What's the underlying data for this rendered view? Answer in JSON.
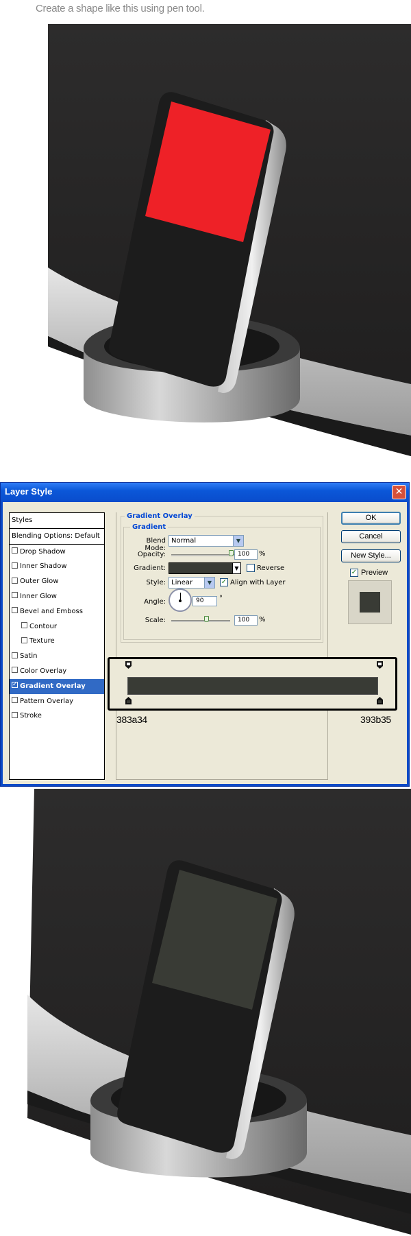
{
  "caption": "Create a shape like this using pen tool.",
  "dialog": {
    "title": "Layer Style",
    "styles_header": "Styles",
    "blending_options": "Blending Options: Default",
    "style_items": [
      {
        "label": "Drop Shadow",
        "checked": false
      },
      {
        "label": "Inner Shadow",
        "checked": false
      },
      {
        "label": "Outer Glow",
        "checked": false
      },
      {
        "label": "Inner Glow",
        "checked": false
      },
      {
        "label": "Bevel and Emboss",
        "checked": false
      },
      {
        "label": "Contour",
        "checked": false
      },
      {
        "label": "Texture",
        "checked": false
      },
      {
        "label": "Satin",
        "checked": false
      },
      {
        "label": "Color Overlay",
        "checked": false
      },
      {
        "label": "Gradient Overlay",
        "checked": true
      },
      {
        "label": "Pattern Overlay",
        "checked": false
      },
      {
        "label": "Stroke",
        "checked": false
      }
    ],
    "section_title": "Gradient Overlay",
    "group_title": "Gradient",
    "blend_mode_label": "Blend Mode:",
    "blend_mode_value": "Normal",
    "opacity_label": "Opacity:",
    "opacity_value": "100",
    "percent": "%",
    "gradient_label": "Gradient:",
    "reverse_label": "Reverse",
    "style_label": "Style:",
    "style_value": "Linear",
    "align_label": "Align with Layer",
    "angle_label": "Angle:",
    "angle_value": "90",
    "degree": "°",
    "scale_label": "Scale:",
    "scale_value": "100",
    "buttons": {
      "ok": "OK",
      "cancel": "Cancel",
      "new_style": "New Style...",
      "preview": "Preview"
    },
    "preview_checked": true,
    "preview_color": "#393b35"
  },
  "gradient_editor": {
    "stop_left_hex": "383a34",
    "stop_right_hex": "393b35",
    "start_color": "#383a34",
    "end_color": "#393b35"
  },
  "colors": {
    "accent_red_screen": "#ee2127",
    "gradient_screen": "#393b35"
  }
}
